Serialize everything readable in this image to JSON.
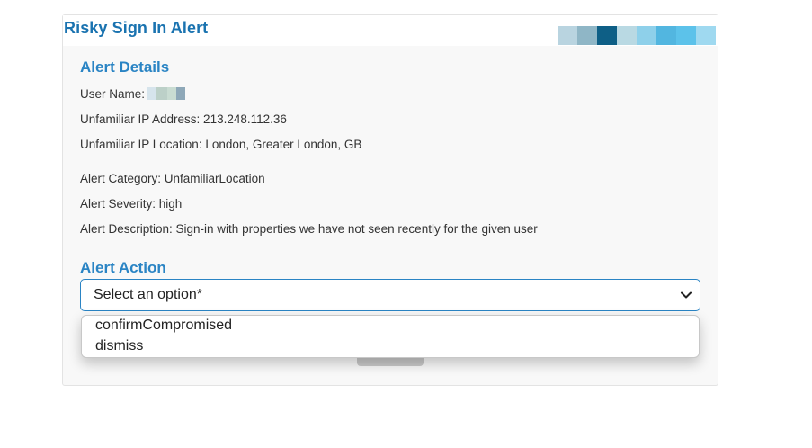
{
  "card": {
    "title": "Risky Sign In Alert"
  },
  "logo": {
    "colors": [
      "#b9d4e0",
      "#8fb6c6",
      "#0e5f86",
      "#b9d9e3",
      "#8ed0ea",
      "#52b6e0",
      "#5cc2ea",
      "#9fd9f0"
    ]
  },
  "details": {
    "heading": "Alert Details",
    "user_name_label": "User Name:",
    "user_name_blur_colors": [
      "#d6e4ec",
      "#bcd0c8",
      "#c9dcd2",
      "#8ea8b8"
    ],
    "ip_address": "Unfamiliar IP Address: 213.248.112.36",
    "ip_location": "Unfamiliar IP Location: London, Greater London, GB",
    "category": "Alert Category: UnfamiliarLocation",
    "severity": "Alert Severity: high",
    "description": "Alert Description: Sign-in with properties we have not seen recently for the given user"
  },
  "action": {
    "heading": "Alert Action",
    "select_placeholder": "Select an option*",
    "options": [
      "confirmCompromised",
      "dismiss"
    ]
  },
  "colors": {
    "accent": "#2a84c4",
    "title": "#1a73b0"
  }
}
